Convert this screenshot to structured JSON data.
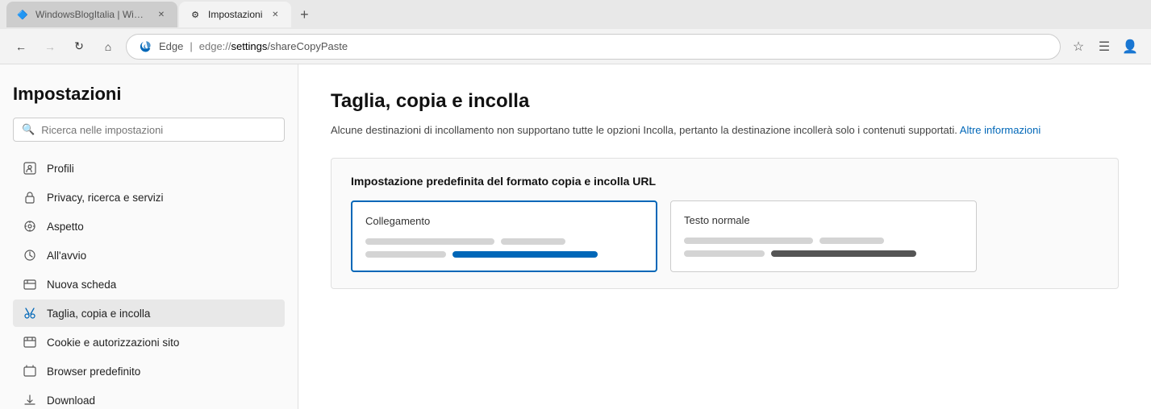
{
  "browser": {
    "tabs": [
      {
        "id": "tab-1",
        "label": "WindowsBlogItalia | Windows, S...",
        "favicon": "🔷",
        "active": false
      },
      {
        "id": "tab-2",
        "label": "Impostazioni",
        "favicon": "⚙",
        "active": true
      }
    ],
    "new_tab_label": "+",
    "address_bar": {
      "browser_name": "Edge",
      "url_prefix": "edge://",
      "url_path": "settings",
      "url_suffix": "/shareCopyPaste",
      "full_url": "edge://settings/shareCopyPaste"
    },
    "nav": {
      "back_disabled": false,
      "forward_disabled": true
    }
  },
  "sidebar": {
    "title": "Impostazioni",
    "search_placeholder": "Ricerca nelle impostazioni",
    "items": [
      {
        "id": "profili",
        "label": "Profili",
        "icon": "👤"
      },
      {
        "id": "privacy",
        "label": "Privacy, ricerca e servizi",
        "icon": "🔒"
      },
      {
        "id": "aspetto",
        "label": "Aspetto",
        "icon": "🎨"
      },
      {
        "id": "allavvio",
        "label": "All'avvio",
        "icon": "⏻"
      },
      {
        "id": "nuova-scheda",
        "label": "Nuova scheda",
        "icon": "🗔"
      },
      {
        "id": "taglia-copia-incolla",
        "label": "Taglia, copia e incolla",
        "icon": "✂",
        "active": true
      },
      {
        "id": "cookie",
        "label": "Cookie e autorizzazioni sito",
        "icon": "🏠"
      },
      {
        "id": "browser-predefinito",
        "label": "Browser predefinito",
        "icon": "🖥"
      },
      {
        "id": "download",
        "label": "Download",
        "icon": "↓"
      }
    ]
  },
  "main": {
    "page_title": "Taglia, copia e incolla",
    "description": "Alcune destinazioni di incollamento non supportano tutte le opzioni Incolla, pertanto la destinazione incollerà solo i contenuti supportati.",
    "more_info_link": "Altre informazioni",
    "format_section": {
      "title": "Impostazione predefinita del formato copia e incolla URL",
      "cards": [
        {
          "id": "collegamento",
          "label": "Collegamento",
          "selected": true
        },
        {
          "id": "testo-normale",
          "label": "Testo normale",
          "selected": false
        }
      ]
    }
  },
  "icons": {
    "back": "←",
    "forward": "→",
    "refresh": "↻",
    "home": "⌂",
    "bookmark": "☆",
    "favorites": "☰",
    "profile": "👤"
  }
}
